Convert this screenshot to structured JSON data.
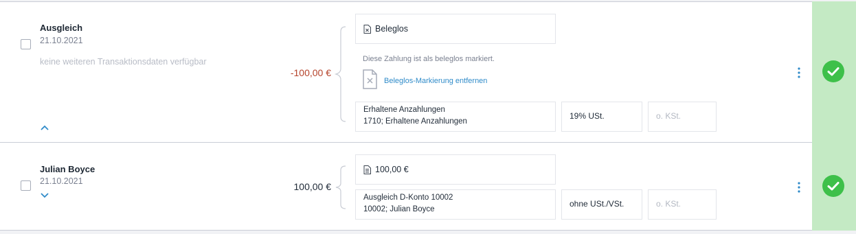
{
  "transactions": [
    {
      "name": "Ausgleich",
      "date": "21.10.2021",
      "info": "keine weiteren Transaktionsdaten verfügbar",
      "amount": "-100,00 €",
      "document": {
        "label": "Beleglos",
        "note": "Diese Zahlung ist als beleglos markiert.",
        "action": "Beleglos-Markierung entfernen"
      },
      "booking": {
        "account_title": "Erhaltene Anzahlungen",
        "account_detail": "1710; Erhaltene Anzahlungen",
        "tax": "19% USt.",
        "cost_center_placeholder": "o. KSt."
      }
    },
    {
      "name": "Julian Boyce",
      "date": "21.10.2021",
      "amount": "100,00 €",
      "document": {
        "label": "100,00 €"
      },
      "booking": {
        "account_title": "Ausgleich D-Konto 10002",
        "account_detail": "10002; Julian Boyce",
        "tax": "ohne USt./VSt.",
        "cost_center_placeholder": "o. KSt."
      }
    }
  ],
  "colors": {
    "negative_amount": "#b5432b",
    "link": "#2f8bc9",
    "status_bg": "#c4eac4",
    "status_check": "#3ec04a"
  }
}
